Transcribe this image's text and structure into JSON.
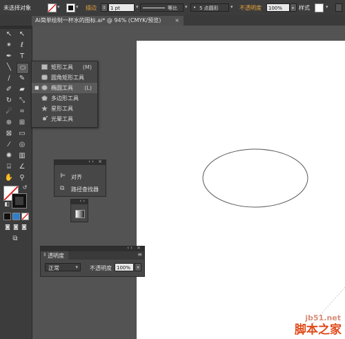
{
  "control_bar": {
    "selection_status": "未选择对象",
    "stroke_label": "描边",
    "stroke_weight": "1 pt",
    "stroke_profile": "等比",
    "brush": "5 点圆形",
    "opacity_label": "不透明度",
    "opacity_value": "100%",
    "style_label": "样式"
  },
  "document_tab": {
    "title": "Ai简单绘制一杯水的图标.ai* @ 94% (CMYK/预览)",
    "close": "×"
  },
  "tool_flyout": {
    "items": [
      {
        "icon": "rectangle-icon",
        "label": "矩形工具",
        "shortcut": "(M)"
      },
      {
        "icon": "rounded-rectangle-icon",
        "label": "圆角矩形工具",
        "shortcut": ""
      },
      {
        "icon": "ellipse-icon",
        "label": "椭圆工具",
        "shortcut": "(L)"
      },
      {
        "icon": "polygon-icon",
        "label": "多边形工具",
        "shortcut": ""
      },
      {
        "icon": "star-icon",
        "label": "星形工具",
        "shortcut": ""
      },
      {
        "icon": "flare-icon",
        "label": "光晕工具",
        "shortcut": ""
      }
    ],
    "selected_index": 2
  },
  "align_panel": {
    "items": [
      {
        "icon": "align-icon",
        "label": "对齐"
      },
      {
        "icon": "pathfinder-icon",
        "label": "路径查找器"
      }
    ]
  },
  "transparency_panel": {
    "title": "透明度",
    "blend_mode": "正常",
    "opacity_label": "不透明度",
    "opacity_value": "100%"
  },
  "watermark": {
    "site": "jb51.net",
    "name": "脚本之家"
  },
  "colors": {
    "accent_orange": "#e8a23c",
    "panel_bg": "#474747",
    "workspace": "#535353",
    "artboard": "#ffffff"
  }
}
